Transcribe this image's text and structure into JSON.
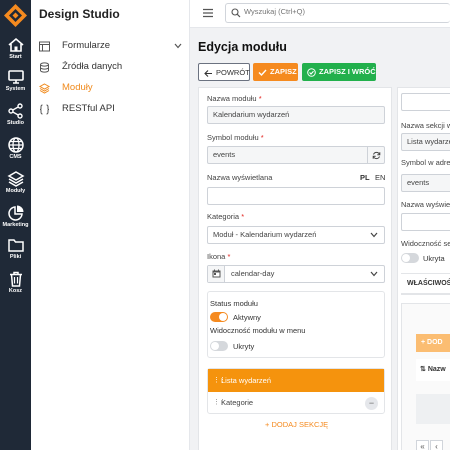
{
  "rail": {
    "items": [
      {
        "label": "Start",
        "icon": "home-icon"
      },
      {
        "label": "System",
        "icon": "monitor-icon"
      },
      {
        "label": "Studio",
        "icon": "share-nodes-icon"
      },
      {
        "label": "CMS",
        "icon": "globe-icon"
      },
      {
        "label": "Moduły",
        "icon": "layers-icon"
      },
      {
        "label": "Marketing",
        "icon": "pie-chart-icon"
      },
      {
        "label": "Pliki",
        "icon": "folder-icon"
      },
      {
        "label": "Kosz",
        "icon": "trash-icon"
      }
    ]
  },
  "sidebar": {
    "title": "Design Studio",
    "items": [
      {
        "label": "Formularze",
        "icon": "form-icon"
      },
      {
        "label": "Źródła danych",
        "icon": "database-icon"
      },
      {
        "label": "Moduły",
        "icon": "layers-icon",
        "active": true
      },
      {
        "label": "RESTful API",
        "icon": "braces-icon"
      }
    ]
  },
  "topbar": {
    "search_placeholder": "Wyszukaj (Ctrl+Q)"
  },
  "page": {
    "title": "Edycja modułu"
  },
  "toolbar": {
    "back_label": "POWRÓT",
    "save_label": "ZAPISZ",
    "save_back_label": "ZAPISZ I WRÓĆ"
  },
  "form": {
    "module_name_label": "Nazwa modułu",
    "module_name_value": "Kalendarium wydarzeń",
    "symbol_label": "Symbol modułu",
    "symbol_value": "events",
    "display_name_label": "Nazwa wyświetlana",
    "lang_pl": "PL",
    "lang_en": "EN",
    "display_name_value": "",
    "category_label": "Kategoria",
    "category_value": "Moduł - Kalendarium wydarzeń",
    "icon_label": "Ikona",
    "icon_value": "calendar-day",
    "status_label": "Status modułu",
    "status_value": "Aktywny",
    "status_on": true,
    "menu_visibility_label": "Widoczność modułu w menu",
    "menu_visibility_value": "Ukryty",
    "menu_visibility_on": false,
    "required_mark": "*"
  },
  "sections": {
    "items": [
      "Lista wydarzeń",
      "Kategorie"
    ],
    "active_index": 0,
    "add_label": "+ DODAJ SEKCJĘ"
  },
  "section_panel": {
    "section_name_label": "Nazwa sekcji w",
    "section_name_value": "Lista wydarze",
    "symbol_addr_label": "Symbol w adres",
    "symbol_addr_value": "events",
    "display_label": "Nazwa wyświetl",
    "visibility_label": "Widoczność sek",
    "visibility_value": "Ukryta",
    "tab_label": "WŁAŚCIWOŚ",
    "add_button": "+ DOD",
    "column_header": "Nazw",
    "sort_icon": "sort-icon",
    "pager_first": "«",
    "pager_prev": "‹"
  },
  "colors": {
    "accent": "#f58a1f",
    "success": "#22b04c",
    "rail_bg": "#1f2937"
  }
}
